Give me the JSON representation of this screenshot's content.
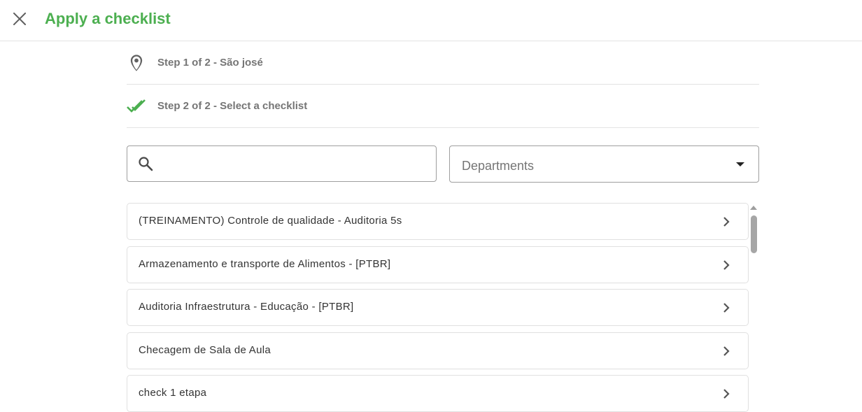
{
  "header": {
    "title": "Apply a checklist",
    "close_icon": "close-icon",
    "accent_color": "#4caf50"
  },
  "steps": [
    {
      "label": "Step 1 of 2 - São josé",
      "icon": "location-pin-icon"
    },
    {
      "label": "Step 2 of 2 - Select a checklist",
      "icon": "double-check-icon"
    }
  ],
  "search": {
    "value": "",
    "placeholder": "",
    "icon": "search-icon"
  },
  "departments": {
    "placeholder": "Departments",
    "icon": "caret-down-icon"
  },
  "checklists": [
    {
      "label": "(TREINAMENTO) Controle de qualidade - Auditoria 5s"
    },
    {
      "label": "Armazenamento e transporte de Alimentos - [PTBR]"
    },
    {
      "label": "Auditoria Infraestrutura - Educação - [PTBR]"
    },
    {
      "label": "Checagem de Sala de Aula"
    },
    {
      "label": "check 1 etapa"
    }
  ]
}
